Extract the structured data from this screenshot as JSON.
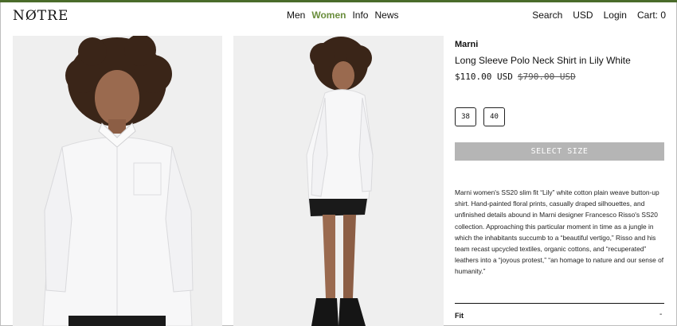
{
  "header": {
    "logo": "NØTRE",
    "nav": [
      "Men",
      "Women",
      "Info",
      "News"
    ],
    "right": [
      "Search",
      "USD",
      "Login",
      "Cart: 0"
    ]
  },
  "colors": {
    "accent": "#6a8e3d",
    "topline": "#4a6b2a",
    "button_disabled": "#b5b5b5"
  },
  "product": {
    "brand": "Marni",
    "title": "Long Sleeve Polo Neck Shirt in Lily White",
    "price": "$110.00 USD",
    "old_price": "$790.00 USD",
    "sizes": [
      "38",
      "40"
    ],
    "select_label": "SELECT SIZE",
    "description": "Marni women's SS20 slim fit “Lily” white cotton plain weave button-up shirt. Hand-painted floral prints, casually draped silhouettes, and unfinished details abound in Marni designer Francesco Risso's SS20 collection. Approaching this particular moment in time as a jungle in which the inhabitants succumb to a “beautiful vertigo,” Risso and his team recast upcycled textiles, organic cottons, and “recuperated” leathers into a “joyous protest,” “an homage to nature and our sense of humanity.”",
    "accordion": {
      "label": "Fit",
      "toggle": "-"
    }
  }
}
